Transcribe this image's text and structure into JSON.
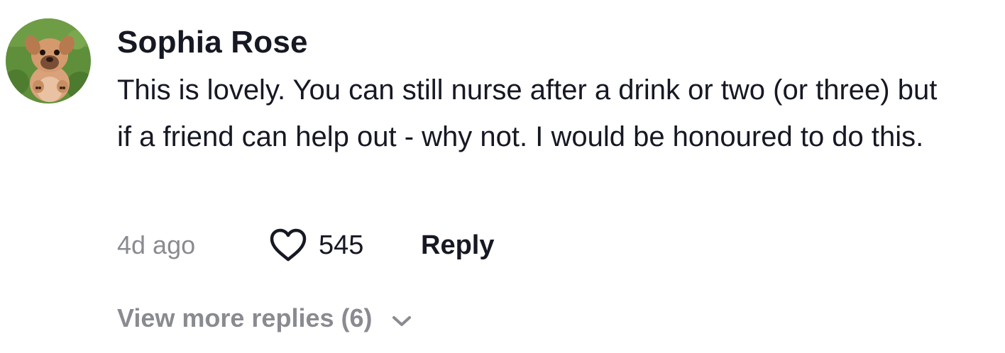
{
  "comment": {
    "username": "Sophia Rose",
    "avatar_icon": "dog-avatar-icon",
    "text": "This is lovely. You can still nurse after a drink or two (or three) but if a friend can help out - why not. I would be honoured to do this.",
    "timestamp": "4d ago",
    "like_icon": "heart-outline-icon",
    "like_count": "545",
    "reply_label": "Reply"
  },
  "replies": {
    "view_more_label": "View more replies (6)",
    "chevron_icon": "chevron-down-icon"
  },
  "colors": {
    "primary_text": "#161823",
    "secondary_text": "#8a8b91",
    "background": "#ffffff"
  }
}
